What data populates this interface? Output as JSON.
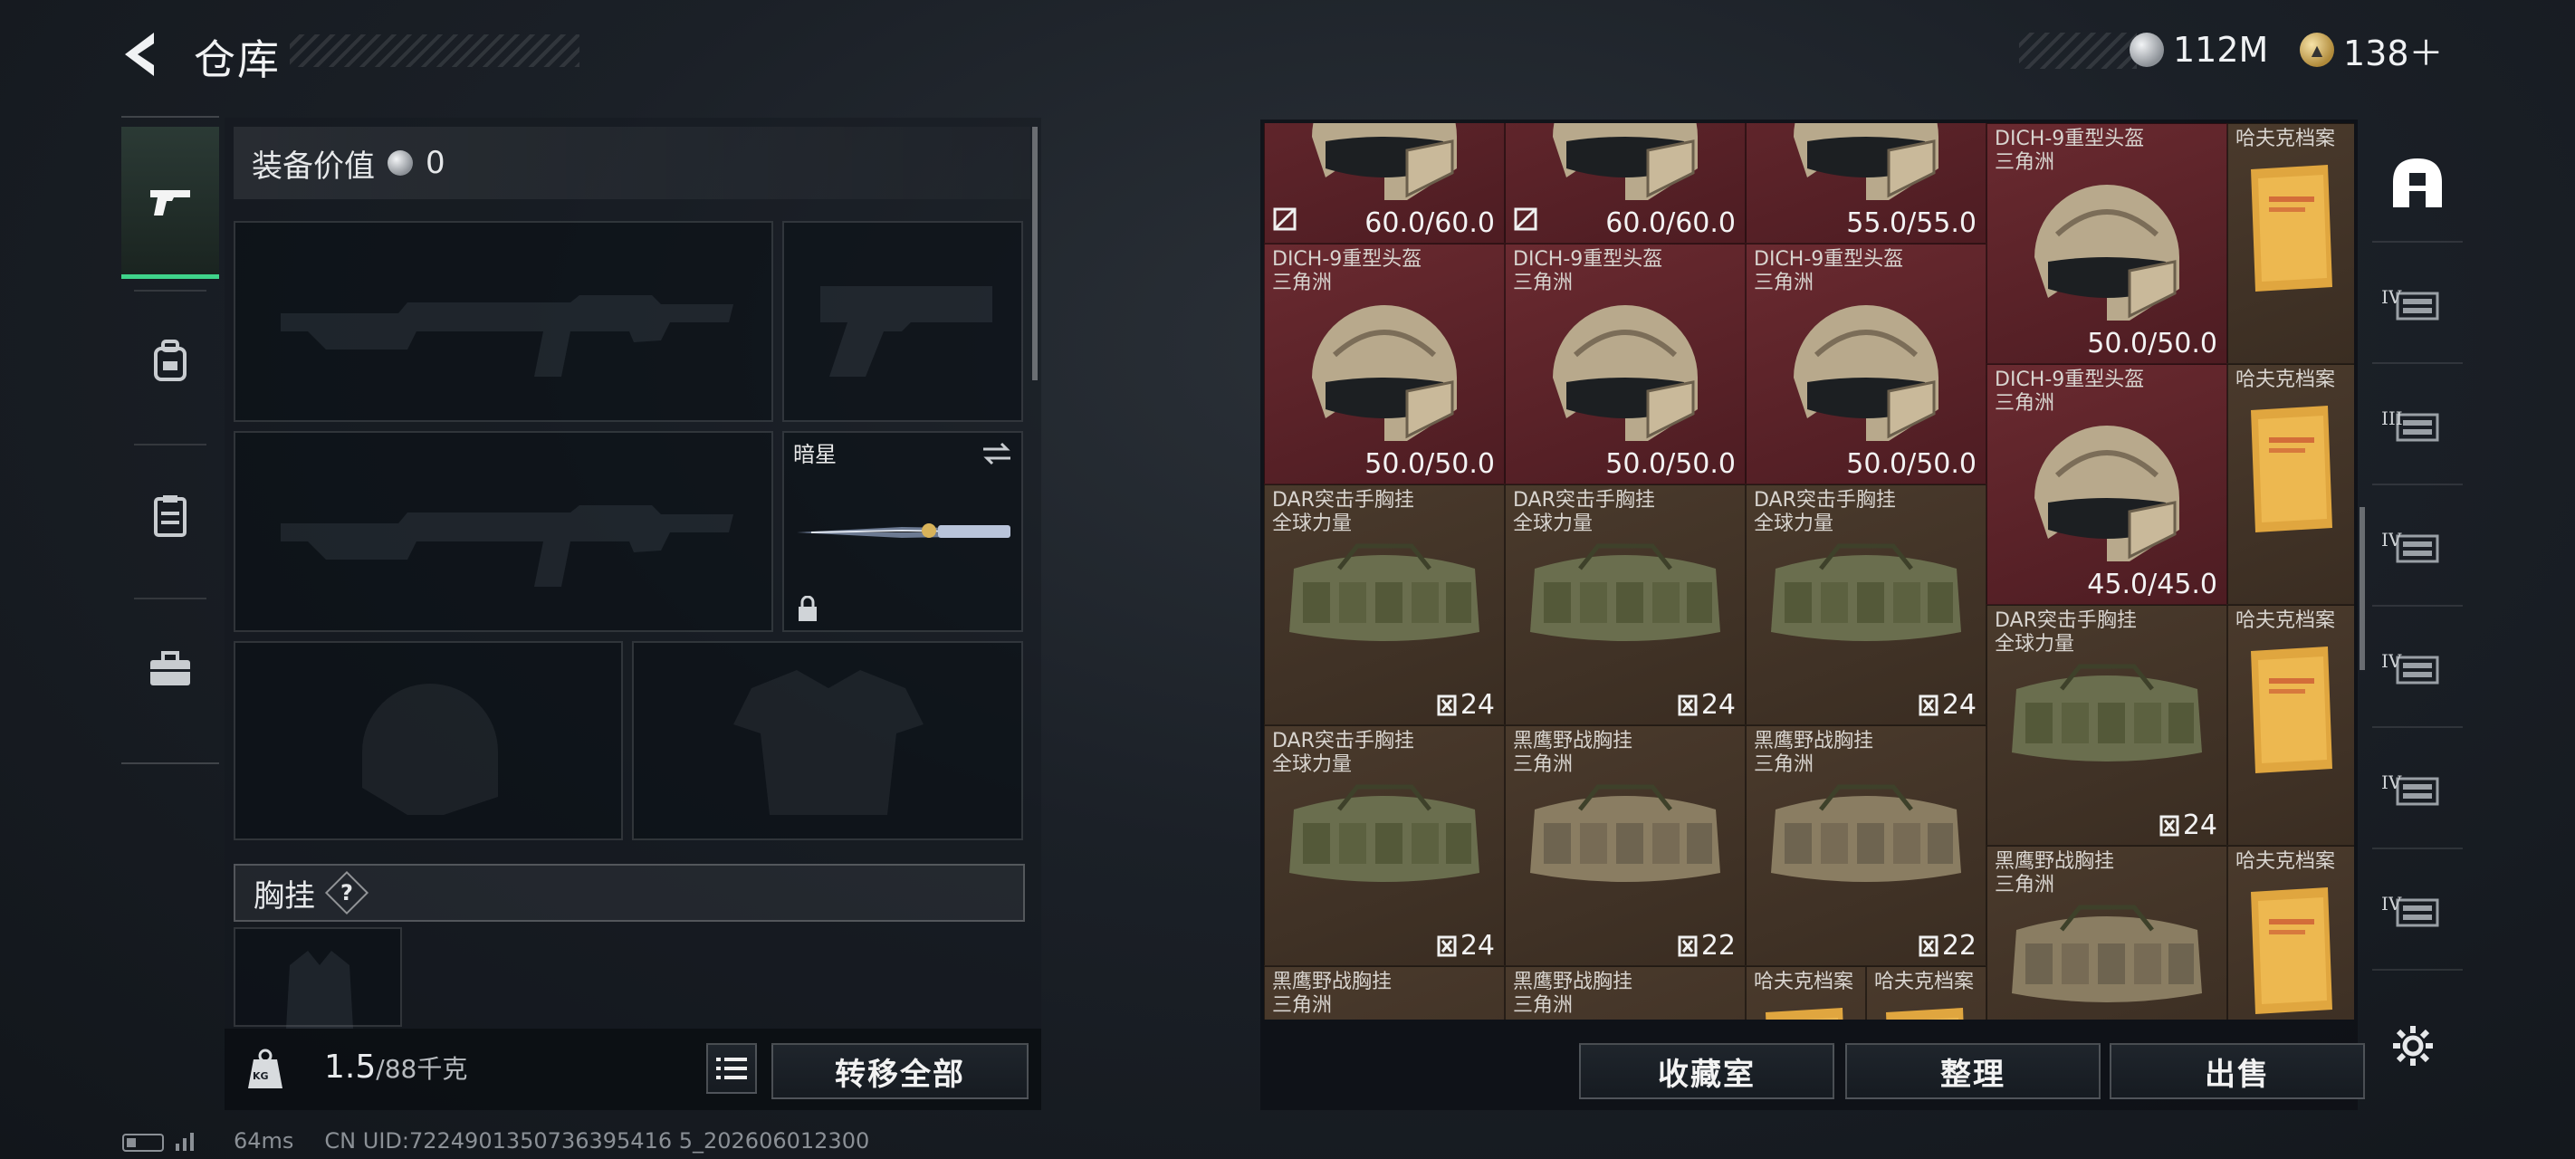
{
  "header": {
    "title": "仓库",
    "currency": [
      {
        "icon": "silver-coin-icon",
        "value": "112M"
      },
      {
        "icon": "gold-coin-icon",
        "value": "138＋"
      }
    ]
  },
  "left_nav": [
    {
      "name": "weapons",
      "icon": "pistol-icon",
      "active": true
    },
    {
      "name": "backpack",
      "icon": "backpack-icon",
      "active": false
    },
    {
      "name": "clipboard",
      "icon": "clipboard-icon",
      "active": false
    },
    {
      "name": "toolbox",
      "icon": "toolbox-icon",
      "active": false
    }
  ],
  "equipment": {
    "value_label": "装备价值",
    "value": "0",
    "knife_name": "暗星",
    "chest_rig_label": "胸挂",
    "help_symbol": "?"
  },
  "bottom_bar": {
    "weight_current": "1.5",
    "weight_max": "/88千克",
    "weight_icon_label": "KG",
    "transfer_all": "转移全部"
  },
  "inventory": {
    "items": [
      {
        "name": "",
        "sub": "",
        "durability": "60.0/60.0",
        "broken": true,
        "bg": "red"
      },
      {
        "name": "",
        "sub": "",
        "durability": "60.0/60.0",
        "broken": true,
        "bg": "red"
      },
      {
        "name": "",
        "sub": "",
        "durability": "55.0/55.0",
        "broken": false,
        "bg": "red"
      },
      {
        "name": "DICH-9重型头盔",
        "sub": "三角洲",
        "durability": "50.0/50.0",
        "bg": "red"
      },
      {
        "name": "哈夫克档案",
        "sub": "",
        "bg": "brown"
      },
      {
        "name": "DICH-9重型头盔",
        "sub": "三角洲",
        "durability": "50.0/50.0",
        "bg": "red"
      },
      {
        "name": "DICH-9重型头盔",
        "sub": "三角洲",
        "durability": "50.0/50.0",
        "bg": "red"
      },
      {
        "name": "DICH-9重型头盔",
        "sub": "三角洲",
        "durability": "50.0/50.0",
        "bg": "red"
      },
      {
        "name": "DICH-9重型头盔",
        "sub": "三角洲",
        "durability": "45.0/45.0",
        "bg": "red"
      },
      {
        "name": "哈夫克档案",
        "sub": "",
        "bg": "brown"
      },
      {
        "name": "DAR突击手胸挂",
        "sub": "全球力量",
        "count": "24",
        "bg": "brown"
      },
      {
        "name": "DAR突击手胸挂",
        "sub": "全球力量",
        "count": "24",
        "bg": "brown"
      },
      {
        "name": "DAR突击手胸挂",
        "sub": "全球力量",
        "count": "24",
        "bg": "brown"
      },
      {
        "name": "DAR突击手胸挂",
        "sub": "全球力量",
        "count": "24",
        "bg": "brown"
      },
      {
        "name": "哈夫克档案",
        "sub": "",
        "bg": "brown"
      },
      {
        "name": "DAR突击手胸挂",
        "sub": "全球力量",
        "count": "24",
        "bg": "brown"
      },
      {
        "name": "黑鹰野战胸挂",
        "sub": "三角洲",
        "count": "22",
        "bg": "brown"
      },
      {
        "name": "黑鹰野战胸挂",
        "sub": "三角洲",
        "count": "22",
        "bg": "brown"
      },
      {
        "name": "黑鹰野战胸挂",
        "sub": "三角洲",
        "count": "",
        "bg": "brown"
      },
      {
        "name": "哈夫克档案",
        "sub": "",
        "bg": "brown"
      },
      {
        "name": "黑鹰野战胸挂",
        "sub": "三角洲",
        "bg": "brown"
      },
      {
        "name": "黑鹰野战胸挂",
        "sub": "三角洲",
        "bg": "brown"
      },
      {
        "name": "哈夫克档案",
        "sub": "",
        "bg": "brown"
      },
      {
        "name": "哈夫克档案",
        "sub": "",
        "bg": "brown"
      }
    ]
  },
  "actions": {
    "collection": "收藏室",
    "sort": "整理",
    "sell": "出售"
  },
  "right_nav": [
    {
      "icon": "shelter-icon",
      "level": ""
    },
    {
      "icon": "storage-iv-icon",
      "level": "IV"
    },
    {
      "icon": "storage-iii-icon",
      "level": "III"
    },
    {
      "icon": "storage-add-icon",
      "level": "IV"
    },
    {
      "icon": "storage-iv-2-icon",
      "level": "IV"
    },
    {
      "icon": "storage-iv-3-icon",
      "level": "IV"
    },
    {
      "icon": "storage-iv-4-icon",
      "level": "IV"
    }
  ],
  "footer": {
    "ping": "64ms",
    "uid": "CN UID:7224901350736395416 5_202606012300"
  },
  "colors": {
    "accent_green": "#3fd38a",
    "cell_red": "#5e2329",
    "cell_brown": "#433428"
  }
}
